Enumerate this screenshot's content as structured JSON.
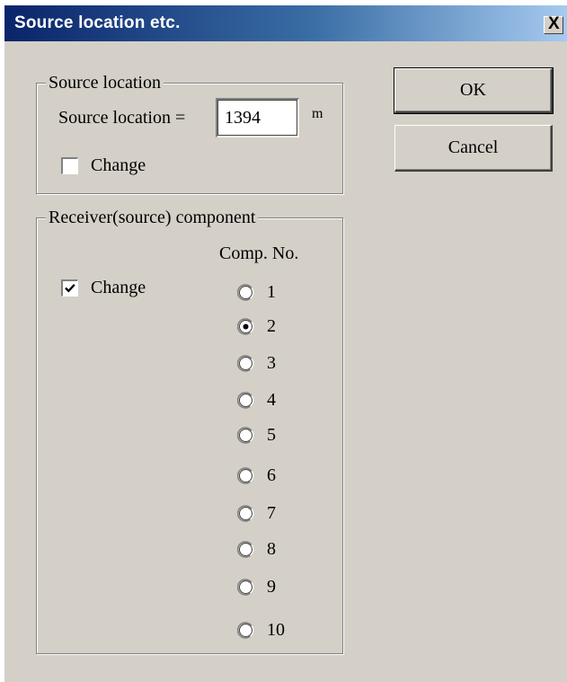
{
  "window": {
    "title": "Source location etc.",
    "close_symbol": "X"
  },
  "source_group": {
    "legend": "Source location",
    "field_label": "Source location =",
    "field_value": "1394",
    "unit": "m",
    "change_checkbox": {
      "label": "Change",
      "checked": false
    }
  },
  "component_group": {
    "legend": "Receiver(source) component",
    "comp_header": "Comp. No.",
    "change_checkbox": {
      "label": "Change",
      "checked": true
    },
    "options": [
      "1",
      "2",
      "3",
      "4",
      "5",
      "6",
      "7",
      "8",
      "9",
      "10"
    ],
    "selected": "2"
  },
  "buttons": {
    "ok_label": "OK",
    "cancel_label": "Cancel"
  }
}
